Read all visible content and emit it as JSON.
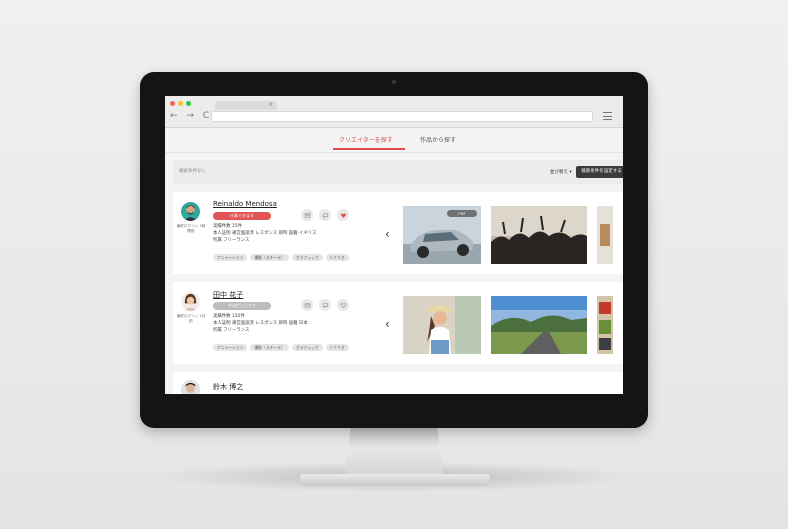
{
  "browser": {
    "tab_close": "×",
    "nav": "← → C"
  },
  "tabs": {
    "creators": "クリエイターを探す",
    "works": "作品から探す"
  },
  "filter": {
    "empty_label": "検索条件なし",
    "sort_label": "並び替え ▾",
    "set_button": "検索条件を設定する"
  },
  "creators": [
    {
      "name": "Reinaldo Mendosa",
      "status": "仕事できます",
      "last_login": "最終ログイン 3時間前",
      "track_record": "実績件数 15件",
      "verification": "本人証明 運営面談済 レスポンス 即時 国籍 イギリス",
      "affiliation": "所属 フリーランス",
      "tags": [
        "アニメーション",
        "撮影（スチール）",
        "グラフィック",
        "シナリオ"
      ],
      "badge": "PDF"
    },
    {
      "name": "田中 花子",
      "status": "今は忙しいです",
      "last_login": "最終ログイン 1日前",
      "track_record": "実績件数 150件",
      "verification": "本人証明 運営面談済 レスポンス 即時 国籍 日本",
      "affiliation": "所属 フリーランス",
      "tags": [
        "アニメーション",
        "撮影（スチール）",
        "グラフィック",
        "シナリオ"
      ]
    },
    {
      "name": "鈴木 博之"
    }
  ],
  "arrows": {
    "prev": "‹",
    "next": "›"
  },
  "colors": {
    "accent_red": "#e04a4a",
    "status_available": "#e25454",
    "status_busy": "#bdbdbd",
    "dark_button": "#3b3b3b"
  }
}
